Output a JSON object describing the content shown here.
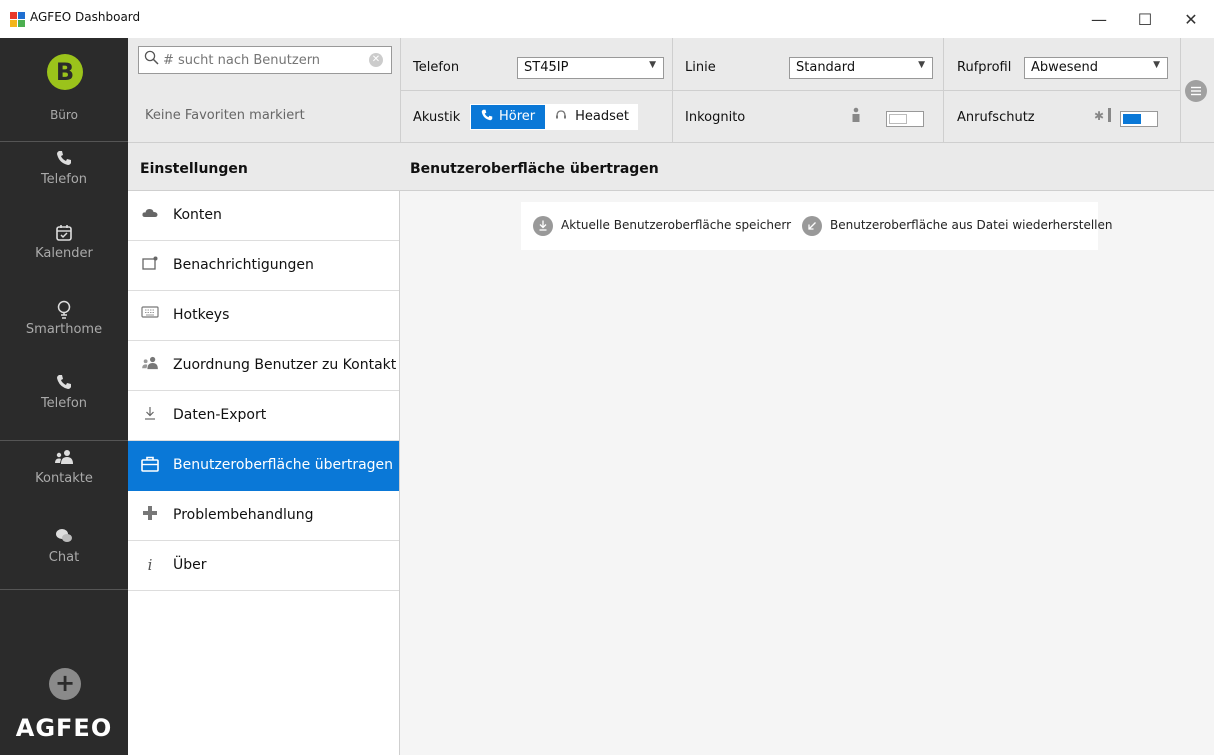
{
  "window": {
    "title": "AGFEO Dashboard",
    "minimize": "—",
    "maximize": "☐",
    "close": "✕"
  },
  "rail": {
    "avatar_letter": "B",
    "avatar_label": "Büro",
    "items": [
      {
        "label": "Telefon",
        "icon": "phone-icon"
      },
      {
        "label": "Kalender",
        "icon": "calendar-icon"
      },
      {
        "label": "Smarthome",
        "icon": "bulb-icon"
      },
      {
        "label": "Telefon",
        "icon": "phone-icon"
      },
      {
        "label": "Kontakte",
        "icon": "contacts-icon"
      },
      {
        "label": "Chat",
        "icon": "chat-icon"
      }
    ],
    "add_button": "+",
    "logo": "AGFEO"
  },
  "topbar": {
    "search_placeholder": "# sucht nach Benutzern",
    "favorites_text": "Keine Favoriten markiert",
    "telefon_label": "Telefon",
    "telefon_value": "ST45IP",
    "linie_label": "Linie",
    "linie_value": "Standard",
    "rufprofil_label": "Rufprofil",
    "rufprofil_value": "Abwesend",
    "akustik_label": "Akustik",
    "hoerer_label": "Hörer",
    "headset_label": "Headset",
    "inkognito_label": "Inkognito",
    "anrufschutz_label": "Anrufschutz"
  },
  "settings": {
    "header": "Einstellungen",
    "items": [
      {
        "label": "Konten",
        "icon": "cloud-icon"
      },
      {
        "label": "Benachrichtigungen",
        "icon": "notification-icon"
      },
      {
        "label": "Hotkeys",
        "icon": "keyboard-icon"
      },
      {
        "label": "Zuordnung Benutzer zu Kontakt",
        "icon": "users-icon"
      },
      {
        "label": "Daten-Export",
        "icon": "download-icon"
      },
      {
        "label": "Benutzeroberfläche übertragen",
        "icon": "briefcase-icon",
        "active": true
      },
      {
        "label": "Problembehandlung",
        "icon": "medical-cross-icon"
      },
      {
        "label": "Über",
        "icon": "info-icon"
      }
    ]
  },
  "main": {
    "header": "Benutzeroberfläche übertragen",
    "save_action": "Aktuelle Benutzeroberfläche speicherr",
    "restore_action": "Benutzeroberfläche aus Datei wiederherstellen"
  },
  "colors": {
    "accent": "#0a78d7",
    "avatar": "#9bc31b",
    "rail": "#2b2b2b"
  }
}
